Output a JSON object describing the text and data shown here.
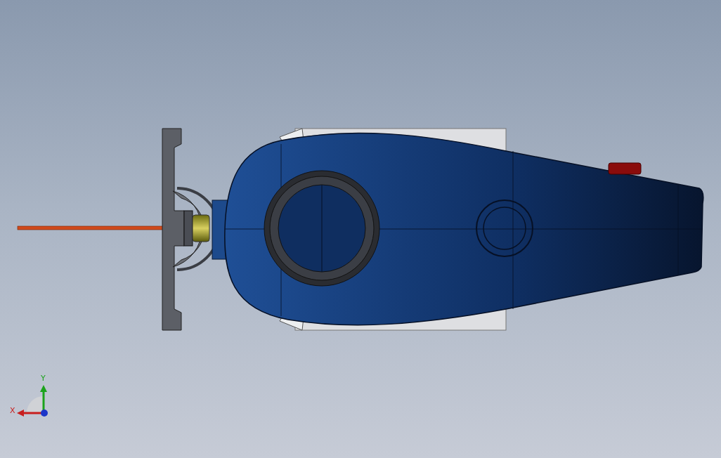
{
  "triad": {
    "x_label": "X",
    "y_label": "Y"
  }
}
